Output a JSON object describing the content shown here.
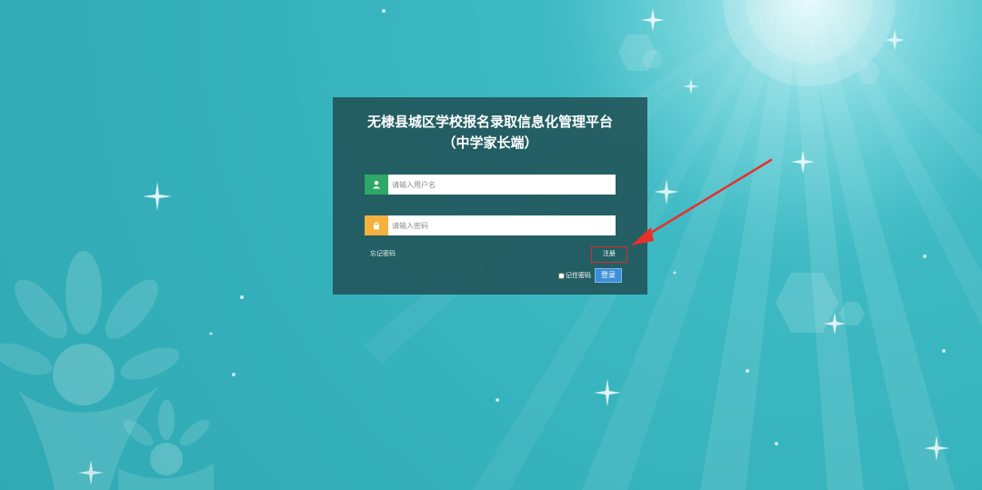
{
  "page": {
    "title_line1": "无棣县城区学校报名录取信息化管理平台",
    "title_line2": "（中学家长端）"
  },
  "form": {
    "username_placeholder": "请输入用户名",
    "password_placeholder": "请输入密码",
    "username_value": "",
    "password_value": "",
    "forgot_password": "忘记密码",
    "register": "注册",
    "remember_label": "记住密码",
    "remember_checked": false,
    "login": "登录"
  },
  "icons": {
    "username": "user-icon",
    "password": "lock-icon"
  },
  "colors": {
    "panel": "#205256",
    "user_icon_bg": "#2ea866",
    "lock_icon_bg": "#f4b13e",
    "login_button": "#3d8fd6",
    "highlight": "#e02b2b"
  }
}
